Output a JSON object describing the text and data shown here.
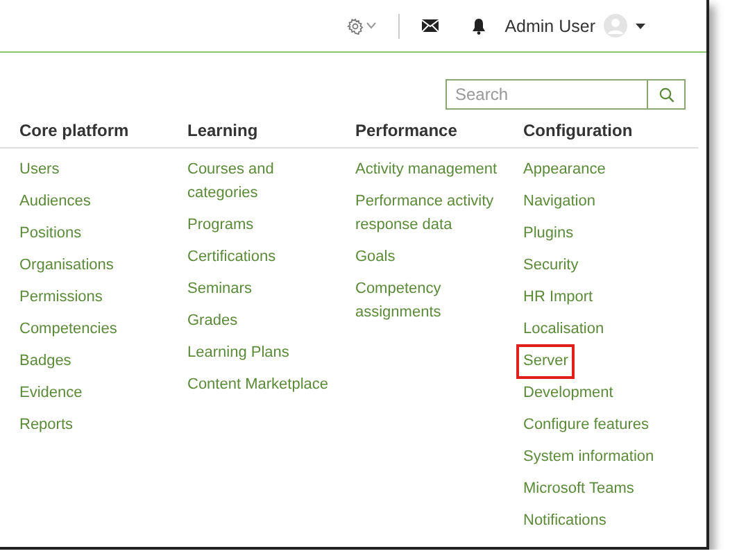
{
  "header": {
    "user_name": "Admin User"
  },
  "search": {
    "placeholder": "Search"
  },
  "columns": [
    {
      "heading": "Core platform",
      "items": [
        {
          "label": "Users",
          "highlighted": false
        },
        {
          "label": "Audiences",
          "highlighted": false
        },
        {
          "label": "Positions",
          "highlighted": false
        },
        {
          "label": "Organisations",
          "highlighted": false
        },
        {
          "label": "Permissions",
          "highlighted": false
        },
        {
          "label": "Competencies",
          "highlighted": false
        },
        {
          "label": "Badges",
          "highlighted": false
        },
        {
          "label": "Evidence",
          "highlighted": false
        },
        {
          "label": "Reports",
          "highlighted": false
        }
      ]
    },
    {
      "heading": "Learning",
      "items": [
        {
          "label": "Courses and categories",
          "highlighted": false
        },
        {
          "label": "Programs",
          "highlighted": false
        },
        {
          "label": "Certifications",
          "highlighted": false
        },
        {
          "label": "Seminars",
          "highlighted": false
        },
        {
          "label": "Grades",
          "highlighted": false
        },
        {
          "label": "Learning Plans",
          "highlighted": false
        },
        {
          "label": "Content Marketplace",
          "highlighted": false
        }
      ]
    },
    {
      "heading": "Performance",
      "items": [
        {
          "label": "Activity management",
          "highlighted": false
        },
        {
          "label": "Performance activity response data",
          "highlighted": false
        },
        {
          "label": "Goals",
          "highlighted": false
        },
        {
          "label": "Competency assignments",
          "highlighted": false
        }
      ]
    },
    {
      "heading": "Configuration",
      "items": [
        {
          "label": "Appearance",
          "highlighted": false
        },
        {
          "label": "Navigation",
          "highlighted": false
        },
        {
          "label": "Plugins",
          "highlighted": false
        },
        {
          "label": "Security",
          "highlighted": false
        },
        {
          "label": "HR Import",
          "highlighted": false
        },
        {
          "label": "Localisation",
          "highlighted": false
        },
        {
          "label": "Server",
          "highlighted": true
        },
        {
          "label": "Development",
          "highlighted": false
        },
        {
          "label": "Configure features",
          "highlighted": false
        },
        {
          "label": "System information",
          "highlighted": false
        },
        {
          "label": "Microsoft Teams",
          "highlighted": false
        },
        {
          "label": "Notifications",
          "highlighted": false
        }
      ]
    }
  ]
}
